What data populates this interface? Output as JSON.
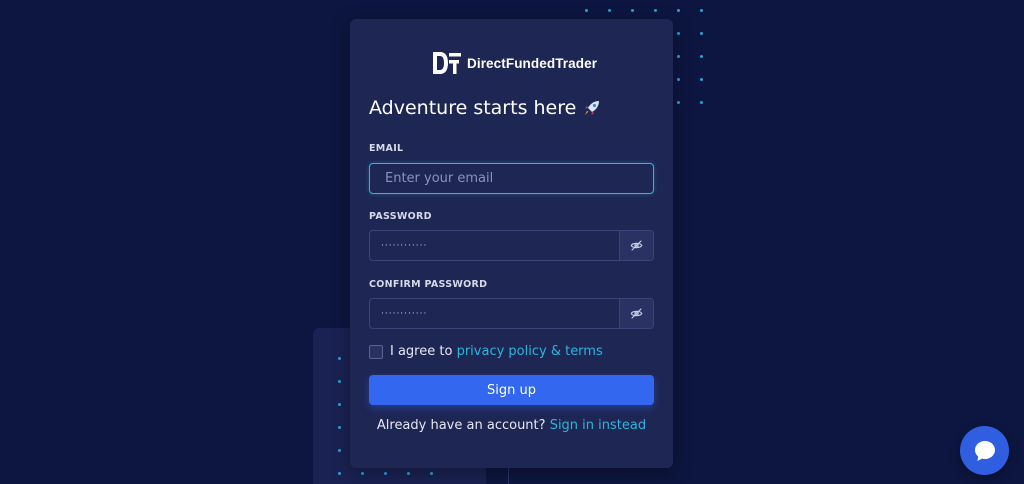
{
  "brand": {
    "name": "DirectFundedTrader",
    "logo_icon": "df-logo-icon"
  },
  "form": {
    "title": "Adventure starts here",
    "title_icon": "rocket-icon",
    "email": {
      "label": "EMAIL",
      "placeholder": "Enter your email",
      "value": ""
    },
    "password": {
      "label": "PASSWORD",
      "value": "············",
      "toggle_icon": "eye-off-icon"
    },
    "confirm_password": {
      "label": "CONFIRM PASSWORD",
      "value": "············",
      "toggle_icon": "eye-off-icon"
    },
    "agree": {
      "text": "I agree to",
      "link": "privacy policy & terms",
      "checked": false
    },
    "submit_label": "Sign up",
    "signin": {
      "text": "Already have an account?",
      "link": "Sign in instead"
    }
  },
  "chat": {
    "icon": "chat-bubble-icon"
  },
  "colors": {
    "background": "#0d1640",
    "card": "#1e2654",
    "accent": "#2bb6dc",
    "primary": "#3367f0"
  }
}
